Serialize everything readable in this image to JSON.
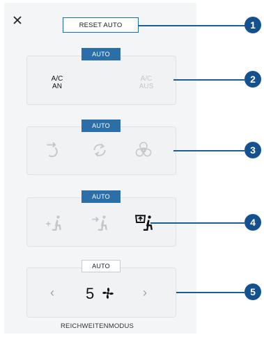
{
  "header": {
    "reset_label": "RESET AUTO"
  },
  "ac": {
    "badge": "AUTO",
    "on_line1": "A/C",
    "on_line2": "AN",
    "off_line1": "A/C",
    "off_line2": "AUS"
  },
  "air": {
    "badge": "AUTO"
  },
  "dist": {
    "badge": "AUTO"
  },
  "fan": {
    "badge": "AUTO",
    "value": "5"
  },
  "footer": {
    "mode_label": "REICHWEITENMODUS"
  },
  "callouts": [
    "1",
    "2",
    "3",
    "4",
    "5"
  ],
  "colors": {
    "accent": "#2b6ea8",
    "callout": "#15518f",
    "disabled": "#c4c7ca"
  },
  "icons": [
    "close-icon",
    "fresh-air-icon",
    "recirculation-icon",
    "biohazard-icon",
    "floor-vent-icon",
    "face-vent-icon",
    "windshield-defrost-icon",
    "fan-icon",
    "chevron-left-icon",
    "chevron-right-icon"
  ]
}
